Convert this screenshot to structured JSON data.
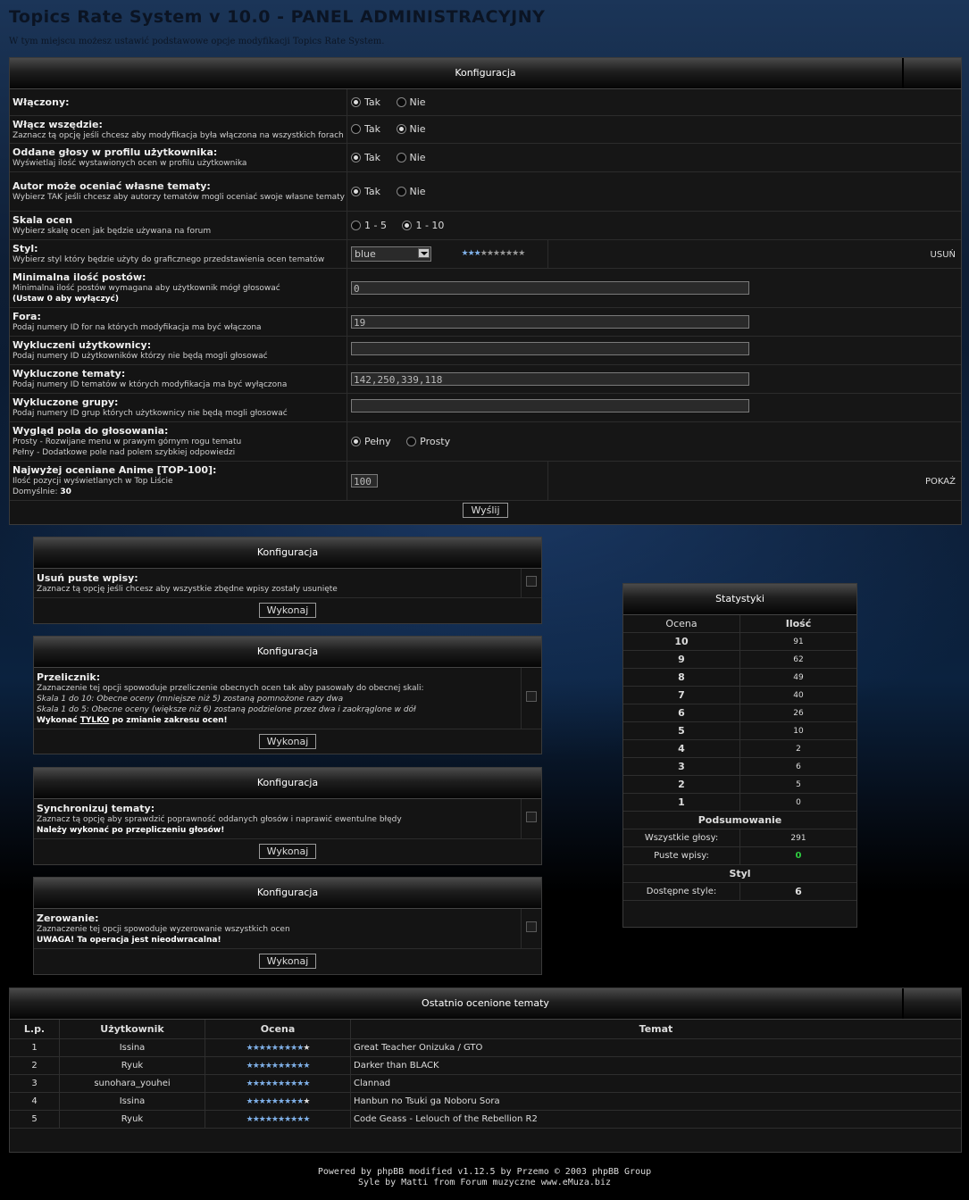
{
  "header": {
    "title": "Topics Rate System v 10.0 - PANEL ADMINISTRACYJNY",
    "description": "W tym miejscu możesz ustawić podstawowe opcje modyfikacji Topics Rate System."
  },
  "config": {
    "title": "Konfiguracja",
    "enabled": {
      "label": "Włączony:",
      "opt_yes": "Tak",
      "opt_no": "Nie",
      "selected": "Tak"
    },
    "enable_all": {
      "label": "Włącz wszędzie:",
      "desc": "Zaznacz tą opcję jeśli chcesz aby modyfikacja była włączona na wszystkich forach",
      "opt_yes": "Tak",
      "opt_no": "Nie",
      "selected": "Nie"
    },
    "profile_votes": {
      "label": "Oddane głosy w profilu użytkownika:",
      "desc": "Wyświetlaj ilość wystawionych ocen w profilu użytkownika",
      "opt_yes": "Tak",
      "opt_no": "Nie",
      "selected": "Tak"
    },
    "author_rate": {
      "label": "Autor może oceniać własne tematy:",
      "desc": "Wybierz TAK jeśli chcesz aby autorzy tematów mogli oceniać swoje własne tematy",
      "opt_yes": "Tak",
      "opt_no": "Nie",
      "selected": "Tak"
    },
    "scale": {
      "label": "Skala ocen",
      "desc": "Wybierz skalę ocen jak będzie używana na forum",
      "opt_a": "1 - 5",
      "opt_b": "1 - 10",
      "selected": "1 - 10"
    },
    "style": {
      "label": "Styl:",
      "desc": "Wybierz styl który będzie użyty do graficznego przedstawienia ocen tematów",
      "value": "blue",
      "delete": "USUŃ"
    },
    "min_posts": {
      "label": "Minimalna ilość postów:",
      "desc": "Minimalna ilość postów wymagana aby użytkownik mógł głosować",
      "desc_bold": "(Ustaw 0 aby wyłączyć)",
      "value": "0"
    },
    "forums": {
      "label": "Fora:",
      "desc": "Podaj numery ID for na których modyfikacja ma być włączona",
      "value": "19"
    },
    "excluded_users": {
      "label": "Wykluczeni użytkownicy:",
      "desc": "Podaj numery ID użytkowników którzy nie będą mogli głosować",
      "value": ""
    },
    "excluded_topics": {
      "label": "Wykluczone tematy:",
      "desc": "Podaj numery ID tematów w których modyfikacja ma być wyłączona",
      "value": "142,250,339,118"
    },
    "excluded_groups": {
      "label": "Wykluczone grupy:",
      "desc": "Podaj numery ID grup których użytkownicy nie będą mogli głosować",
      "value": ""
    },
    "vote_look": {
      "label": "Wygląd pola do głosowania:",
      "desc1": "Prosty - Rozwijane menu w prawym górnym rogu tematu",
      "desc2": "Pełny - Dodatkowe pole nad polem szybkiej odpowiedzi",
      "opt_a": "Pełny",
      "opt_b": "Prosty",
      "selected": "Pełny"
    },
    "top100": {
      "label": "Najwyżej oceniane Anime [TOP-100]:",
      "desc": "Ilość pozycji wyświetlanych w Top Liście",
      "default_label": "Domyślnie:",
      "default_value": "30",
      "value": "100",
      "show": "POKAŻ"
    },
    "submit": "Wyślij"
  },
  "tools": {
    "clean": {
      "title": "Konfiguracja",
      "label": "Usuń puste wpisy:",
      "desc": "Zaznacz tą opcję jeśli chcesz aby wszystkie zbędne wpisy zostały usunięte",
      "button": "Wykonaj"
    },
    "convert": {
      "title": "Konfiguracja",
      "label": "Przelicznik:",
      "desc": "Zaznaczenie tej opcji spowoduje przeliczenie obecnych ocen tak aby pasowały do obecnej skali:",
      "line1": "Skala 1 do 10: Obecne oceny (mniejsze niż 5) zostaną pomnożone razy dwa",
      "line2": "Skala 1 do 5: Obecne oceny (większe niż 6) zostaną podzielone przez dwa i zaokrąglone w dół",
      "warn_a": "Wykonać",
      "warn_b": "TYLKO",
      "warn_c": "po zmianie zakresu ocen!",
      "button": "Wykonaj"
    },
    "sync": {
      "title": "Konfiguracja",
      "label": "Synchronizuj tematy:",
      "desc": "Zaznacz tą opcję aby sprawdzić poprawność oddanych głosów i naprawić ewentulne błędy",
      "warn": "Należy wykonać po przepliczeniu głosów!",
      "button": "Wykonaj"
    },
    "reset": {
      "title": "Konfiguracja",
      "label": "Zerowanie:",
      "desc": "Zaznaczenie tej opcji spowoduje wyzerowanie wszystkich ocen",
      "warn": "UWAGA! Ta operacja jest nieodwracalna!",
      "button": "Wykonaj"
    }
  },
  "stats": {
    "title": "Statystyki",
    "col_rating": "Ocena",
    "col_count": "Ilość",
    "rows": [
      {
        "rating": "10",
        "count": "91"
      },
      {
        "rating": "9",
        "count": "62"
      },
      {
        "rating": "8",
        "count": "49"
      },
      {
        "rating": "7",
        "count": "40"
      },
      {
        "rating": "6",
        "count": "26"
      },
      {
        "rating": "5",
        "count": "10"
      },
      {
        "rating": "4",
        "count": "2"
      },
      {
        "rating": "3",
        "count": "6"
      },
      {
        "rating": "2",
        "count": "5"
      },
      {
        "rating": "1",
        "count": "0"
      }
    ],
    "summary_title": "Podsumowanie",
    "all_votes_label": "Wszystkie głosy:",
    "all_votes": "291",
    "empty_label": "Puste wpisy:",
    "empty": "0",
    "style_title": "Styl",
    "styles_label": "Dostępne style:",
    "styles": "6"
  },
  "recent": {
    "title": "Ostatnio ocenione tematy",
    "col_lp": "L.p.",
    "col_user": "Użytkownik",
    "col_rating": "Ocena",
    "col_topic": "Temat",
    "rows": [
      {
        "lp": "1",
        "user": "Issina",
        "stars": 9,
        "topic": "Great Teacher Onizuka / GTO"
      },
      {
        "lp": "2",
        "user": "Ryuk",
        "stars": 10,
        "topic": "Darker than BLACK"
      },
      {
        "lp": "3",
        "user": "sunohara_youhei",
        "stars": 10,
        "topic": "Clannad"
      },
      {
        "lp": "4",
        "user": "Issina",
        "stars": 9,
        "topic": "Hanbun no Tsuki ga Noboru Sora"
      },
      {
        "lp": "5",
        "user": "Ryuk",
        "stars": 10,
        "topic": "Code Geass - Lelouch of the Rebellion R2"
      }
    ]
  },
  "style_preview_stars": 3,
  "footer": {
    "line1": "Powered by phpBB modified v1.12.5 by Przemo © 2003 phpBB Group",
    "line2": "Syle by Matti from Forum muzyczne www.eMuza.biz"
  },
  "colors": {
    "star_on": "#7fb0e8",
    "star_off": "#777777",
    "empty_count": "#2ecc40"
  }
}
